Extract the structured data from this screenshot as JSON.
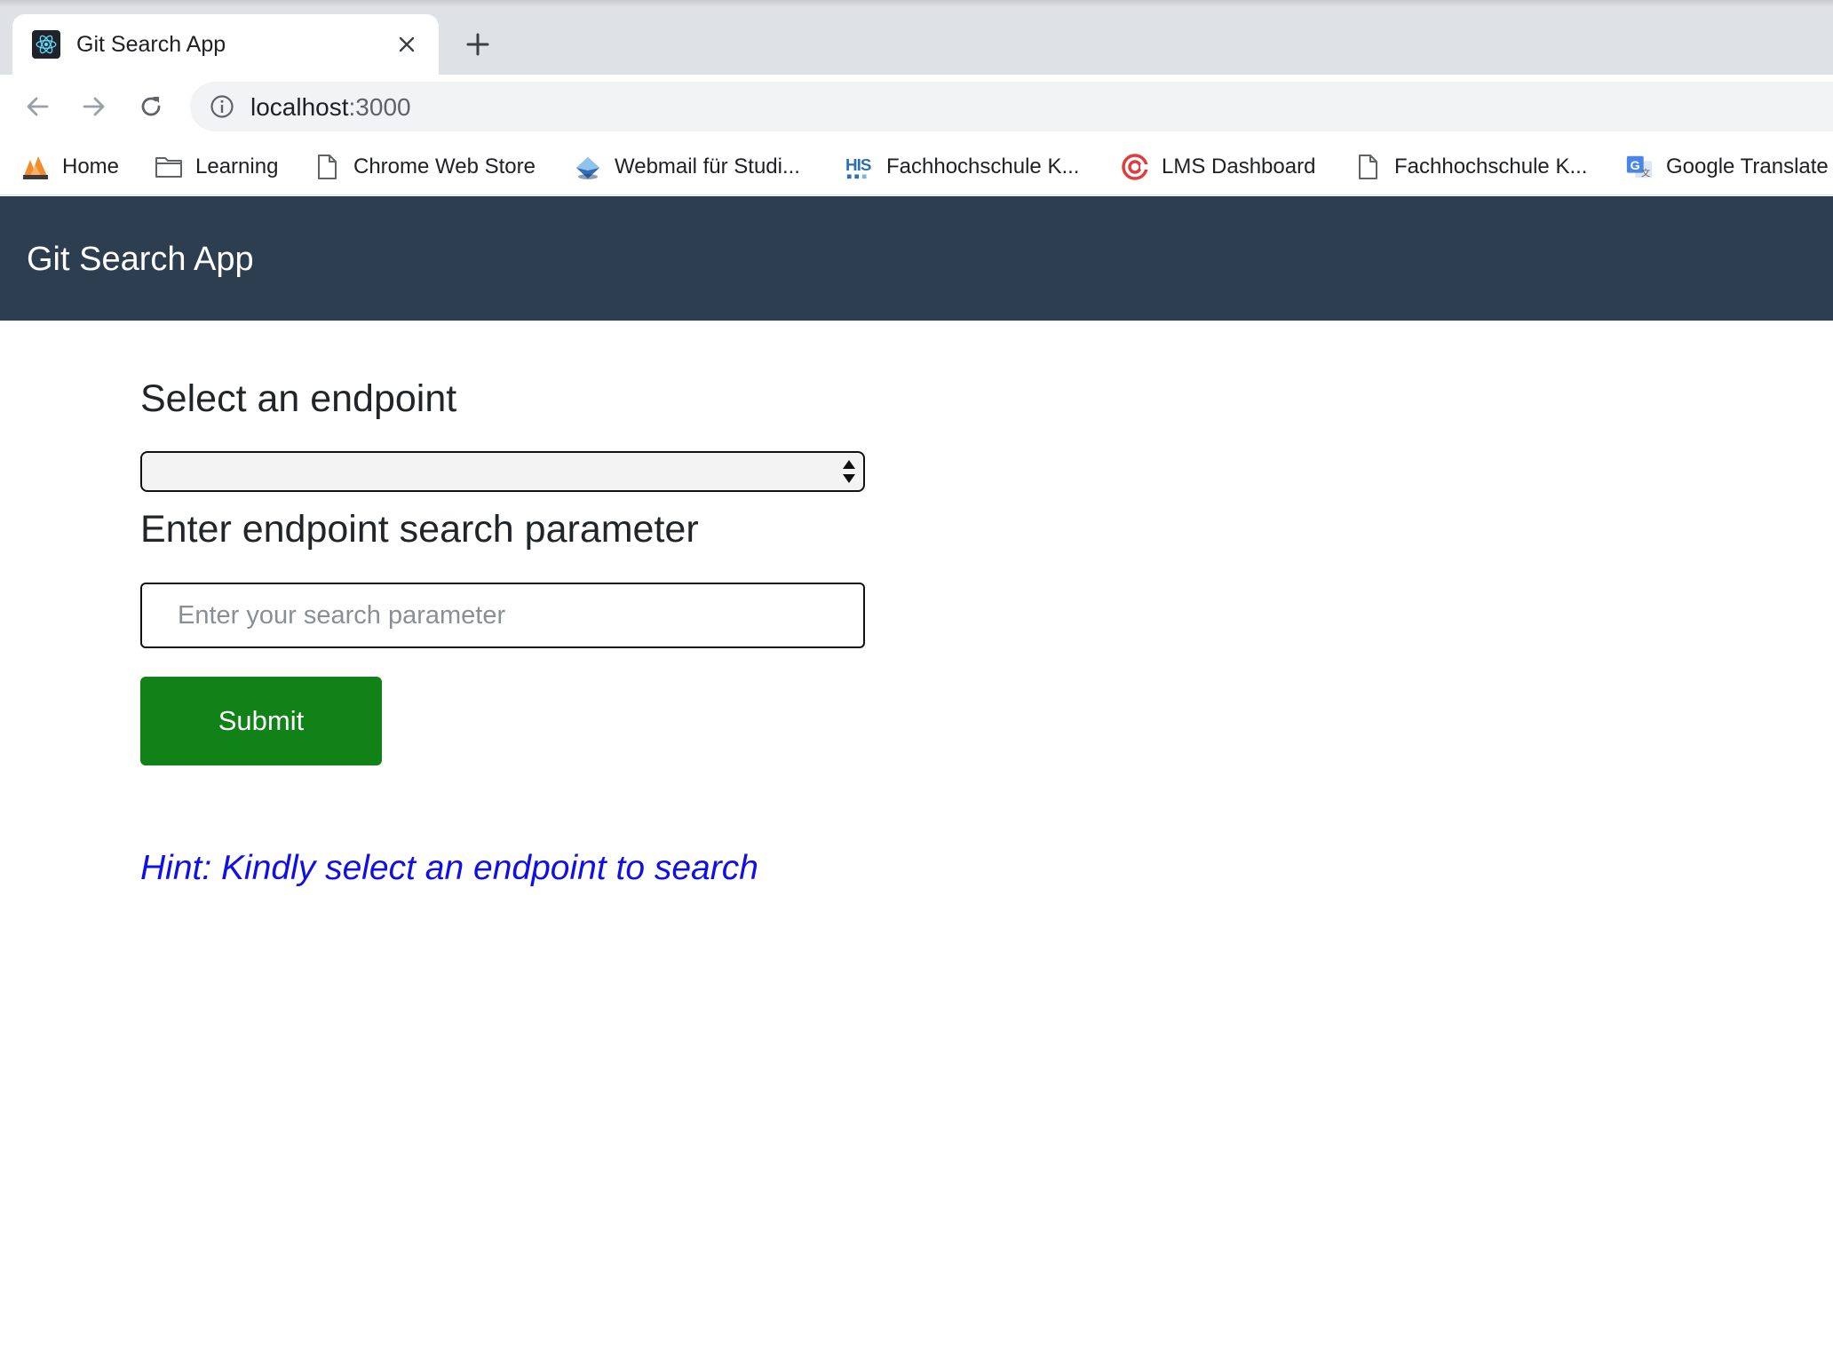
{
  "browser": {
    "tab": {
      "title": "Git Search App",
      "favicon": "react-icon"
    },
    "address_bar": {
      "host": "localhost",
      "port": ":3000"
    },
    "bookmarks": [
      {
        "label": "Home",
        "icon": "pma-icon"
      },
      {
        "label": "Learning",
        "icon": "folder-icon"
      },
      {
        "label": "Chrome Web Store",
        "icon": "page-icon"
      },
      {
        "label": "Webmail für Studi...",
        "icon": "webmail-icon"
      },
      {
        "label": "Fachhochschule K...",
        "icon": "his-icon"
      },
      {
        "label": "LMS Dashboard",
        "icon": "lms-icon"
      },
      {
        "label": "Fachhochschule K...",
        "icon": "page-icon"
      },
      {
        "label": "Google Translate",
        "icon": "google-translate-icon"
      }
    ]
  },
  "app": {
    "header_title": "Git Search App",
    "select_heading": "Select an endpoint",
    "select_value": "",
    "param_heading": "Enter endpoint search parameter",
    "search_input": {
      "value": "",
      "placeholder": "Enter your search parameter"
    },
    "submit_label": "Submit",
    "hint": "Hint: Kindly select an endpoint to search"
  },
  "colors": {
    "header_bg": "#2e3e51",
    "submit_bg": "#118217",
    "hint_text": "#1010e6"
  }
}
